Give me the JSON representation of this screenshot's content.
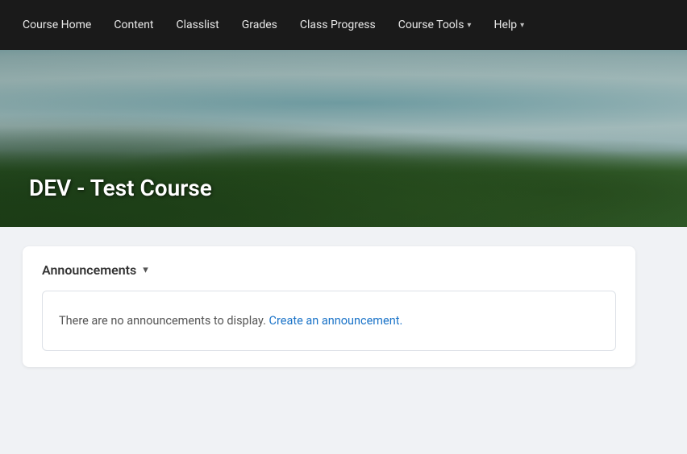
{
  "nav": {
    "items": [
      {
        "id": "course-home",
        "label": "Course Home",
        "hasDropdown": false
      },
      {
        "id": "content",
        "label": "Content",
        "hasDropdown": false
      },
      {
        "id": "classlist",
        "label": "Classlist",
        "hasDropdown": false
      },
      {
        "id": "grades",
        "label": "Grades",
        "hasDropdown": false
      },
      {
        "id": "class-progress",
        "label": "Class Progress",
        "hasDropdown": false
      },
      {
        "id": "course-tools",
        "label": "Course Tools",
        "hasDropdown": true
      },
      {
        "id": "help",
        "label": "Help",
        "hasDropdown": true
      }
    ]
  },
  "hero": {
    "title": "DEV - Test Course"
  },
  "announcements": {
    "header": "Announcements",
    "empty_message": "There are no announcements to display.",
    "create_link_text": "Create an announcement."
  }
}
